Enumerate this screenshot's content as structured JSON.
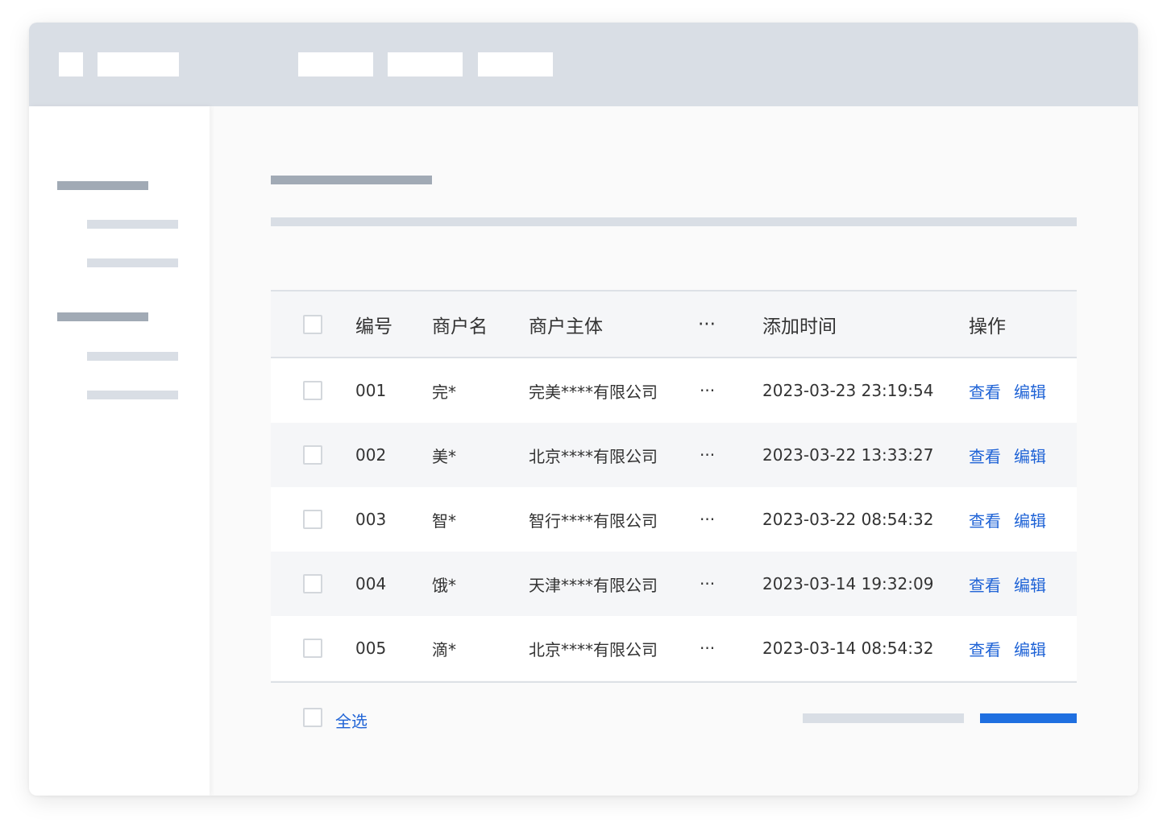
{
  "colors": {
    "topbar": "#d9dee5",
    "placeholder_dark": "#a1aab5",
    "placeholder_light": "#d9dee5",
    "link": "#1f63d6",
    "primary": "#1f6fe0"
  },
  "table": {
    "headers": {
      "id": "编号",
      "merchant_name": "商户名",
      "merchant_entity": "商户主体",
      "more": "···",
      "added_time": "添加时间",
      "actions": "操作"
    },
    "rows": [
      {
        "id": "001",
        "name": "完*",
        "entity": "完美****有限公司",
        "more": "···",
        "time": "2023-03-23 23:19:54",
        "view": "查看",
        "edit": "编辑"
      },
      {
        "id": "002",
        "name": "美*",
        "entity": "北京****有限公司",
        "more": "···",
        "time": "2023-03-22 13:33:27",
        "view": "查看",
        "edit": "编辑"
      },
      {
        "id": "003",
        "name": "智*",
        "entity": "智行****有限公司",
        "more": "···",
        "time": "2023-03-22 08:54:32",
        "view": "查看",
        "edit": "编辑"
      },
      {
        "id": "004",
        "name": "饿*",
        "entity": "天津****有限公司",
        "more": "···",
        "time": "2023-03-14 19:32:09",
        "view": "查看",
        "edit": "编辑"
      },
      {
        "id": "005",
        "name": "滴*",
        "entity": "北京****有限公司",
        "more": "···",
        "time": "2023-03-14 08:54:32",
        "view": "查看",
        "edit": "编辑"
      }
    ]
  },
  "footer": {
    "select_all": "全选"
  }
}
